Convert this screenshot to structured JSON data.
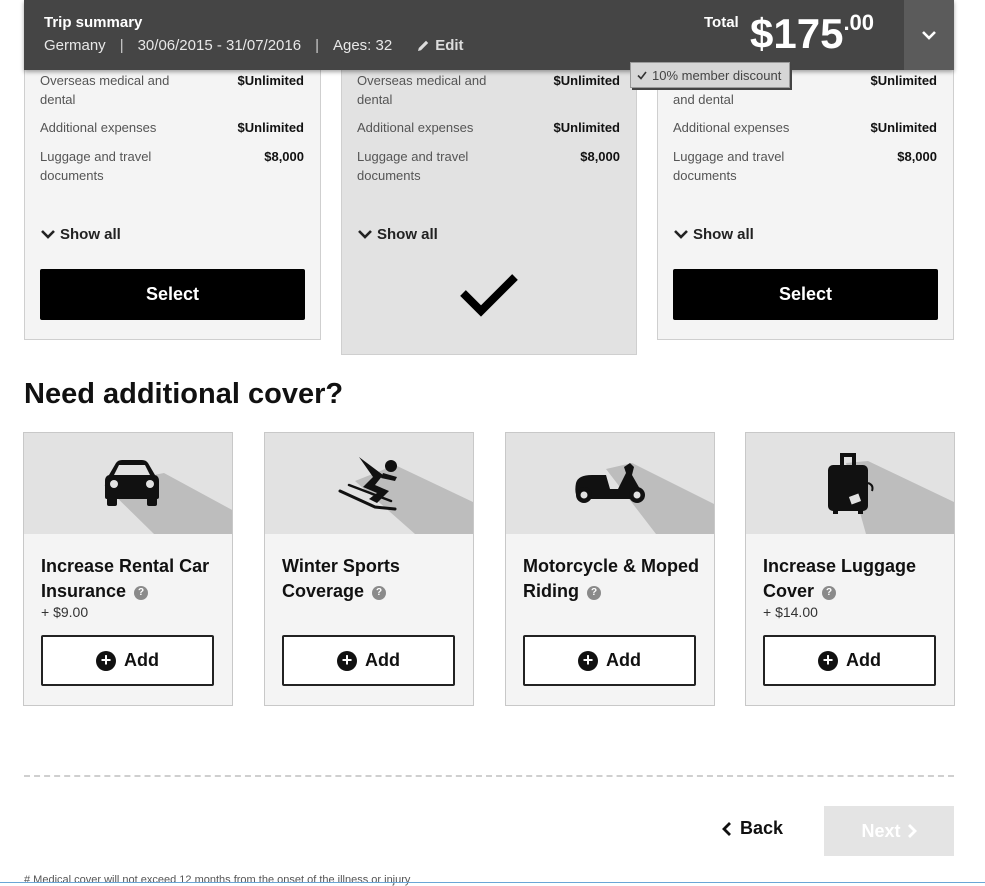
{
  "summary": {
    "title": "Trip summary",
    "destination": "Germany",
    "dates": "30/06/2015 - 31/07/2016",
    "ages": "Ages: 32",
    "edit_label": "Edit",
    "total_label": "Total",
    "price_main": "$175",
    "price_cents": ".00",
    "discount": "10% member discount",
    "separator": "|"
  },
  "plans": [
    {
      "benefits": [
        {
          "label": "Overseas medical and dental",
          "value": "$Unlimited"
        },
        {
          "label": "Additional expenses",
          "value": "$Unlimited"
        },
        {
          "label": "Luggage and travel documents",
          "value": "$8,000"
        }
      ],
      "show_all": "Show all",
      "button": "Select",
      "selected": false
    },
    {
      "benefits": [
        {
          "label": "Overseas medical and dental",
          "value": "$Unlimited"
        },
        {
          "label": "Additional expenses",
          "value": "$Unlimited"
        },
        {
          "label": "Luggage and travel documents",
          "value": "$8,000"
        }
      ],
      "show_all": "Show all",
      "selected": true
    },
    {
      "benefits": [
        {
          "label": "and dental",
          "value": "$Unlimited"
        },
        {
          "label": "Additional expenses",
          "value": "$Unlimited"
        },
        {
          "label": "Luggage and travel documents",
          "value": "$8,000"
        }
      ],
      "show_all": "Show all",
      "button": "Select",
      "selected": false
    }
  ],
  "additional": {
    "heading": "Need additional cover?",
    "items": [
      {
        "name": "Increase Rental Car Insurance",
        "price": "+ $9.00",
        "button": "Add",
        "icon": "car-icon"
      },
      {
        "name": "Winter Sports Coverage",
        "price": "",
        "button": "Add",
        "icon": "skier-icon"
      },
      {
        "name": "Motorcycle & Moped Riding",
        "price": "",
        "button": "Add",
        "icon": "scooter-icon"
      },
      {
        "name": "Increase Luggage Cover",
        "price": "+ $14.00",
        "button": "Add",
        "icon": "luggage-icon"
      }
    ],
    "info_glyph": "?"
  },
  "nav": {
    "back": "Back",
    "next": "Next"
  },
  "footnote": "# Medical cover will not exceed 12 months from the onset of the illness or injury",
  "colors": {
    "summary_bar": "#454545",
    "button_dark": "#000000",
    "card_bg": "#f4f4f4",
    "selected_bg": "#e2e2e2",
    "next_disabled": "#e4e4e4"
  }
}
